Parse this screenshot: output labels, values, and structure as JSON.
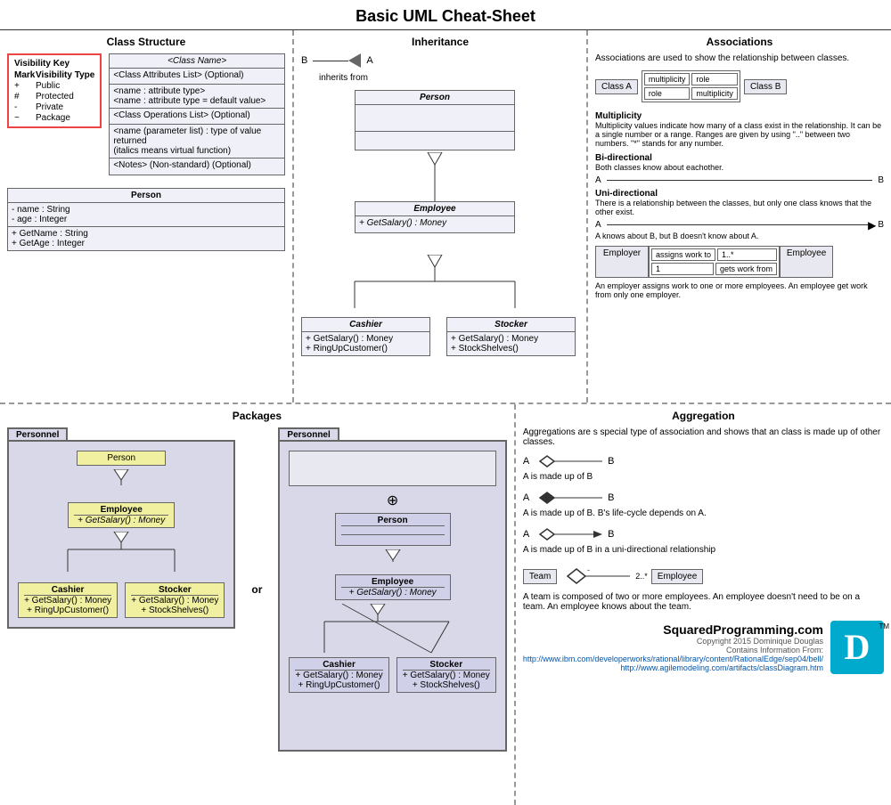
{
  "title": "Basic UML Cheat-Sheet",
  "sections": {
    "class_structure": {
      "label": "Class Structure",
      "visibility_key": {
        "title": "Visibility Key",
        "mark_header": "Mark",
        "type_header": "Visibility Type",
        "items": [
          {
            "mark": "+",
            "type": "Public"
          },
          {
            "mark": "#",
            "type": "Protected"
          },
          {
            "mark": "-",
            "type": "Private"
          },
          {
            "mark": "~",
            "type": "Package"
          }
        ]
      },
      "template_class": {
        "name": "<Class Name>",
        "attributes_label": "<Class Attributes List> (Optional)",
        "attr1": "<name : attribute type>",
        "attr2": "<name : attribute type = default value>",
        "operations_label": "<Class Operations List> (Optional)",
        "op1": "<name (parameter list) : type of value returned",
        "op1b": "(italics means virtual function)",
        "notes_label": "<Notes> (Non-standard) (Optional)"
      },
      "person_class": {
        "name": "Person",
        "attr1": "- name : String",
        "attr2": "- age : Integer",
        "op1": "+ GetName : String",
        "op2": "+ GetAge : Integer"
      }
    },
    "inheritance": {
      "label": "Inheritance",
      "b_label": "B",
      "a_label": "A",
      "inherits_from": "inherits from",
      "person_label": "Person",
      "employee_label": "Employee",
      "employee_op": "+ GetSalary() : Money",
      "cashier_label": "Cashier",
      "cashier_op1": "+ GetSalary() : Money",
      "cashier_op2": "+ RingUpCustomer()",
      "stocker_label": "Stocker",
      "stocker_op1": "+ GetSalary() : Money",
      "stocker_op2": "+ StockShelves()"
    },
    "associations": {
      "label": "Associations",
      "description": "Associations are used to show the relationship between classes.",
      "class_a": "Class A",
      "class_b": "Class B",
      "multiplicity_label": "multiplicity",
      "role_label": "role",
      "multiplicity_title": "Multiplicity",
      "multiplicity_desc": "Multiplicity values indicate how many of a class exist in the relationship. It can be a single number or a range. Ranges are given by using \"..\" between two numbers. \"*\" stands for any number.",
      "bidirectional_title": "Bi-directional",
      "bidirectional_desc": "Both classes know about eachother.",
      "bidir_a": "A",
      "bidir_b": "B",
      "unidirectional_title": "Uni-directional",
      "unidirectional_desc": "There is a relationship between the classes, but only one class knows that the other exist.",
      "unidir_a": "A",
      "unidir_b": "B",
      "unidir_note": "A knows about B, but B doesn't know about A.",
      "employer_label": "Employer",
      "employer_employee_label": "Employee",
      "assigns_work": "assigns work to",
      "one_star": "1..*",
      "one": "1",
      "gets_work": "gets work from",
      "employer_desc": "An employer assigns work to one or more employees. An employee get work from only one employer."
    },
    "packages": {
      "label": "Packages",
      "or_label": "or",
      "pkg1": {
        "name": "Personnel",
        "person_label": "Person",
        "employee_label": "Employee",
        "employee_op": "+ GetSalary() : Money",
        "cashier_label": "Cashier",
        "cashier_op1": "+ GetSalary() : Money",
        "cashier_op2": "+ RingUpCustomer()",
        "stocker_label": "Stocker",
        "stocker_op1": "+ GetSalary() : Money",
        "stocker_op2": "+ StockShelves()"
      },
      "pkg2": {
        "name": "Personnel",
        "person_label": "Person",
        "employee_label": "Employee",
        "employee_op": "+ GetSalary() : Money",
        "cashier_label": "Cashier",
        "cashier_op1": "+ GetSalary() : Money",
        "cashier_op2": "+ RingUpCustomer()",
        "stocker_label": "Stocker",
        "stocker_op1": "+ GetSalary() : Money",
        "stocker_op2": "+ StockShelves()"
      }
    },
    "aggregation": {
      "label": "Aggregation",
      "description": "Aggregations are s special type of association and shows that an class is made up of other classes.",
      "agg1_a": "A",
      "agg1_b": "B",
      "agg1_desc": "A is made up of B",
      "agg2_a": "A",
      "agg2_b": "B",
      "agg2_desc": "A is made up of B. B's life-cycle depends on A.",
      "agg3_a": "A",
      "agg3_b": "B",
      "agg3_desc": "A is made up of B in a uni-directional relationship",
      "team_label": "Team",
      "employee_label": "Employee",
      "team_mult": "-",
      "emp_mult": "2..*",
      "team_desc": "A team is composed of two or more employees. An employee doesn't need to be on a team. An employee knows about the team."
    },
    "logo": {
      "company": "SquaredProgramming.com",
      "copyright": "Copyright 2015 Dominique Douglas",
      "contains_info": "Contains Information From:",
      "link1": "http://www.ibm.com/developerworks/rational/library/content/RationalEdge/sep04/bell/",
      "link2": "http://www.agilemodeling.com/artifacts/classDiagram.htm",
      "tm": "TM"
    }
  }
}
